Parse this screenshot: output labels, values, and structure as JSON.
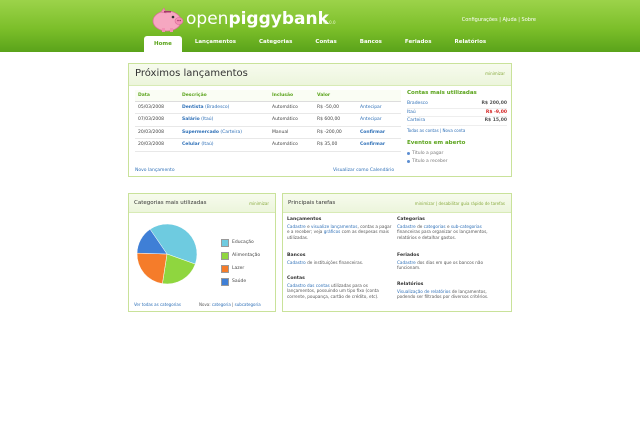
{
  "app": {
    "logo_prefix": "open",
    "logo_main": "piggybank",
    "version": "v1.0.0",
    "top_links": "Configurações | Ajuda | Sobre"
  },
  "nav": [
    "Home",
    "Lançamentos",
    "Categorias",
    "Contas",
    "Bancos",
    "Feriados",
    "Relatórios"
  ],
  "main": {
    "title": "Próximos lançamentos",
    "minimize": "minimizar",
    "columns": [
      "Data",
      "Descrição",
      "Inclusão",
      "Valor",
      ""
    ],
    "rows": [
      {
        "date": "05/03/2008",
        "desc": "Dentista",
        "bank": "(Bradesco)",
        "inc": "Automático",
        "val": "R$ -50,00",
        "act": "Antecipar"
      },
      {
        "date": "07/03/2008",
        "desc": "Salário",
        "bank": "(Itaú)",
        "inc": "Automático",
        "val": "R$ 600,00",
        "act": "Antecipar"
      },
      {
        "date": "20/03/2008",
        "desc": "Supermercado",
        "bank": "(Carteira)",
        "inc": "Manual",
        "val": "R$ -200,00",
        "act": "Confirmar"
      },
      {
        "date": "20/03/2008",
        "desc": "Celular",
        "bank": "(Itaú)",
        "inc": "Automático",
        "val": "R$ 35,00",
        "act": "Confirmar"
      }
    ],
    "new_link": "Novo lançamento",
    "calendar_link": "Visualizar como Calendário",
    "accounts_title": "Contas mais utilizadas",
    "accounts": [
      {
        "name": "Bradesco",
        "value": "R$ 200,00"
      },
      {
        "name": "Itaú",
        "value": "R$ -9,00"
      },
      {
        "name": "Carteira",
        "value": "R$ 15,00"
      }
    ],
    "accounts_links": "Todas as contas | Nova conta",
    "events_title": "Eventos em aberto",
    "events": [
      "Título a pagar",
      "Título a receber"
    ]
  },
  "categories": {
    "title": "Categorias mais utilizadas",
    "minimize": "minimizar",
    "legend": [
      "Educação",
      "Alimentação",
      "Lazer",
      "Saúde"
    ],
    "colors": [
      "#6ecbe0",
      "#8fd63f",
      "#f57c2a",
      "#3f7fd6"
    ],
    "shares": [
      0.4,
      0.22,
      0.23,
      0.15
    ],
    "all_link": "Ver todas as categorias",
    "new_label": "Nova:",
    "new_cat": "categoria",
    "new_sub": "subcategoria"
  },
  "tasks": {
    "title": "Principais tarefas",
    "header_links": "minimizar | desabilitar guia rápido de tarefas",
    "items": [
      {
        "title": "Lançamentos",
        "l1": "Cadastre",
        "t1": " e ",
        "l2": "visualize lançamentos",
        "t2": ", contas a pagar e a receber; veja ",
        "l3": "gráficos",
        "t3": " com as despesas mais utilizadas."
      },
      {
        "title": "Categorias",
        "l1": "Cadastre",
        "t1": " de ",
        "l2": "categorias",
        "t2": " e ",
        "l3": "sub-categorias",
        "t3": " financeiras para organizar os lançamentos, relatórios e detalhar gastos."
      },
      {
        "title": "Bancos",
        "l1": "Cadastro",
        "t1": " de instituições financeiras.",
        "l2": "",
        "t2": "",
        "l3": "",
        "t3": ""
      },
      {
        "title": "Feriados",
        "l1": "Cadastre",
        "t1": " dos dias em que os bancos não funcionam.",
        "l2": "",
        "t2": "",
        "l3": "",
        "t3": ""
      },
      {
        "title": "Contas",
        "l1": "Cadastro das contas",
        "t1": " utilizadas para os lançamentos, possuindo um tipo fixo (conta corrente, poupança, cartão de crédito, etc).",
        "l2": "",
        "t2": "",
        "l3": "",
        "t3": ""
      },
      {
        "title": "Relatórios",
        "l1": "Visualização de relatórios",
        "t1": " de lançamentos, podendo ser filtrados por diversos critérios.",
        "l2": "",
        "t2": "",
        "l3": "",
        "t3": ""
      }
    ]
  }
}
